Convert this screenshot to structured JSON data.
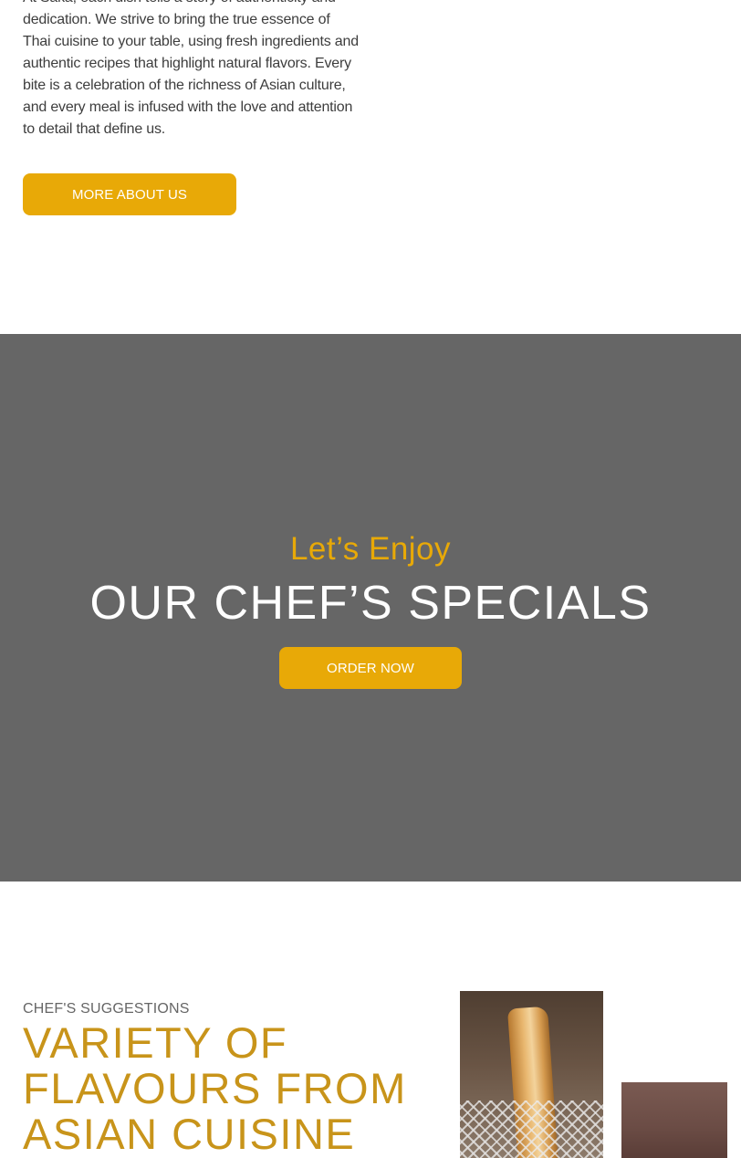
{
  "about": {
    "paragraph": "At Saka, each dish tells a story of authenticity and dedication. We strive to bring the true essence of Thai cuisine to your table, using fresh ingredients and authentic recipes that highlight natural flavors. Every bite is a celebration of the richness of Asian culture, and every meal is infused with the love and attention to detail that define us.",
    "button_label": "MORE ABOUT US"
  },
  "banner": {
    "subtitle": "Let’s Enjoy",
    "title": "OUR CHEF’S SPECIALS",
    "button_label": "ORDER NOW"
  },
  "suggestions": {
    "eyebrow": "CHEF'S SUGGESTIONS",
    "title": "VARIETY OF FLAVOURS FROM ASIAN CUISINE"
  },
  "colors": {
    "accent": "#e8a907",
    "title_gold": "#c8941a",
    "banner_bg": "#666666"
  }
}
